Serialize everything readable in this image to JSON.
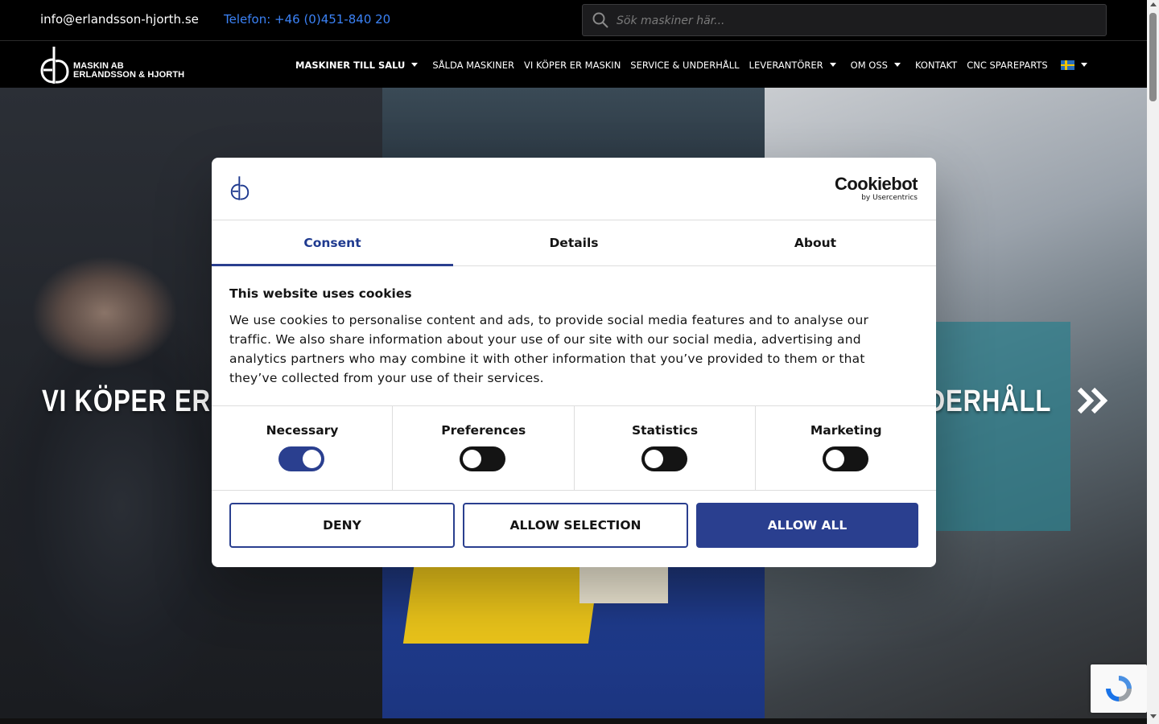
{
  "topbar": {
    "email": "info@erlandsson-hjorth.se",
    "phone": "Telefon: +46 (0)451-840 20",
    "search_placeholder": "Sök maskiner här..."
  },
  "logo": {
    "line1": "MASKIN AB",
    "line2": "ERLANDSSON & HJORTH"
  },
  "nav": {
    "items": [
      {
        "label": "MASKINER TILL SALU",
        "dropdown": true
      },
      {
        "label": "SÅLDA MASKINER",
        "dropdown": false
      },
      {
        "label": "VI KÖPER ER MASKIN",
        "dropdown": false
      },
      {
        "label": "SERVICE & UNDERHÅLL",
        "dropdown": false
      },
      {
        "label": "LEVERANTÖRER",
        "dropdown": true
      },
      {
        "label": "OM OSS",
        "dropdown": true
      },
      {
        "label": "KONTAKT",
        "dropdown": false
      },
      {
        "label": "CNC SPAREPARTS",
        "dropdown": false
      }
    ],
    "language_flag": "swedish-flag"
  },
  "hero": {
    "left_text": "VI KÖPER ER M",
    "right_text": "UNDERHÅLL"
  },
  "cookie_dialog": {
    "provider_name": "Cookiebot",
    "provider_sub": "by Usercentrics",
    "tabs": [
      "Consent",
      "Details",
      "About"
    ],
    "active_tab": "Consent",
    "heading": "This website uses cookies",
    "body": "We use cookies to personalise content and ads, to provide social media features and to analyse our traffic. We also share information about your use of our site with our social media, advertising and analytics partners who may combine it with other information that you’ve provided to them or that they’ve collected from your use of their services.",
    "toggles": [
      {
        "label": "Necessary",
        "on": true
      },
      {
        "label": "Preferences",
        "on": false
      },
      {
        "label": "Statistics",
        "on": false
      },
      {
        "label": "Marketing",
        "on": false
      }
    ],
    "buttons": {
      "deny": "DENY",
      "allow_selection": "ALLOW SELECTION",
      "allow_all": "ALLOW ALL"
    },
    "accent_color": "#2a3f8f"
  },
  "colors": {
    "phone_link": "#3b82f6",
    "header_bg": "#000000"
  }
}
